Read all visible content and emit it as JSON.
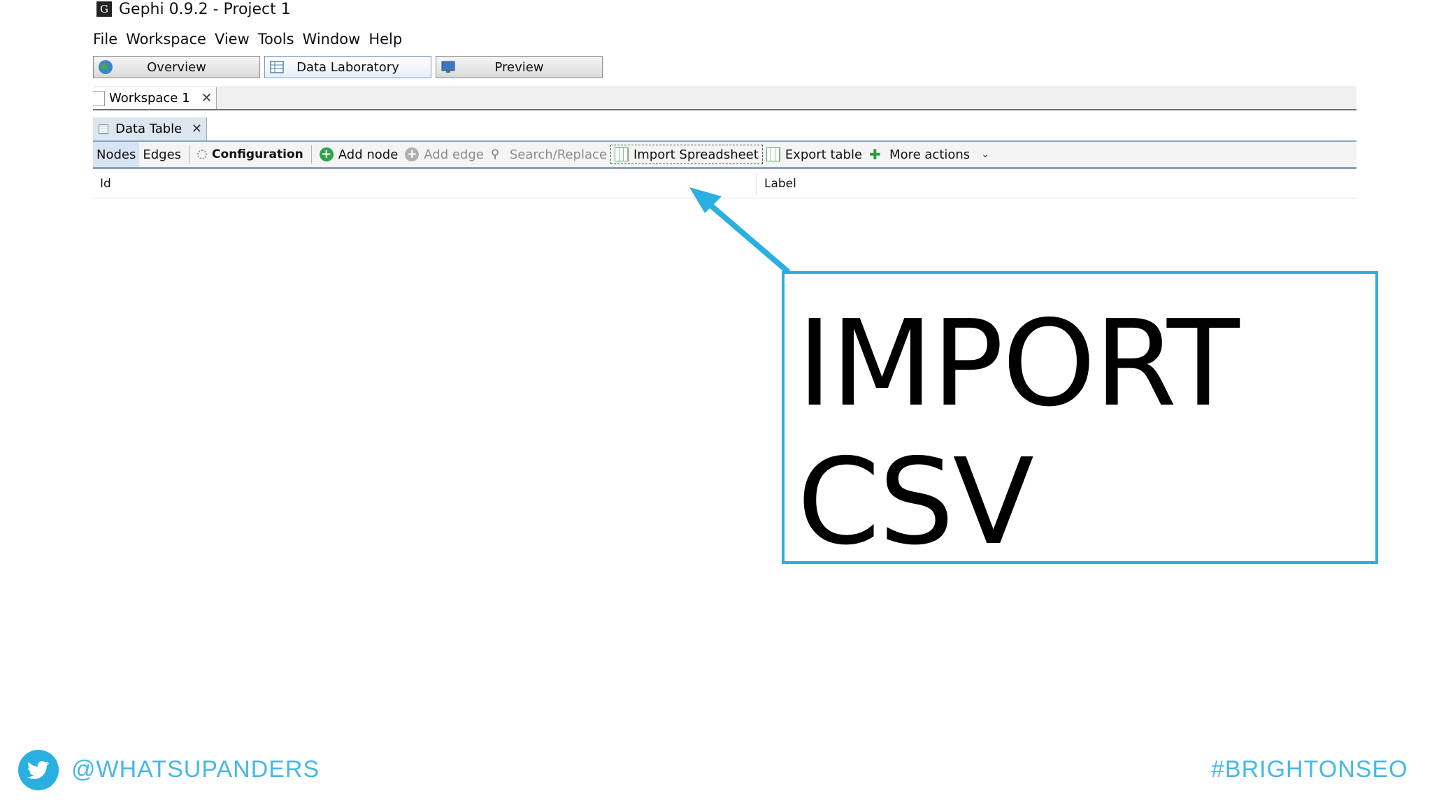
{
  "window": {
    "title": "Gephi 0.9.2 - Project 1"
  },
  "menu": [
    "File",
    "Workspace",
    "View",
    "Tools",
    "Window",
    "Help"
  ],
  "perspectives": [
    {
      "label": "Overview",
      "icon": "globe-icon"
    },
    {
      "label": "Data Laboratory",
      "icon": "table-icon",
      "active": true
    },
    {
      "label": "Preview",
      "icon": "monitor-icon"
    }
  ],
  "workspace_tab": {
    "label": "Workspace 1",
    "close": "✕"
  },
  "data_table_tab": {
    "label": "Data Table",
    "close": "✕"
  },
  "toolbar": {
    "nodes": "Nodes",
    "edges": "Edges",
    "configuration": "Configuration",
    "add_node": "Add node",
    "add_edge": "Add edge",
    "search_replace": "Search/Replace",
    "import_spreadsheet": "Import Spreadsheet",
    "export_table": "Export table",
    "more_actions": "More actions"
  },
  "table": {
    "columns": [
      "Id",
      "Label"
    ]
  },
  "callout": {
    "line1": "IMPORT",
    "line2": "CSV",
    "color": "#2ab0e0"
  },
  "footer": {
    "handle": "@WHATSUPANDERS",
    "hashtag": "#BRIGHTONSEO",
    "accent": "#45b9e6"
  }
}
